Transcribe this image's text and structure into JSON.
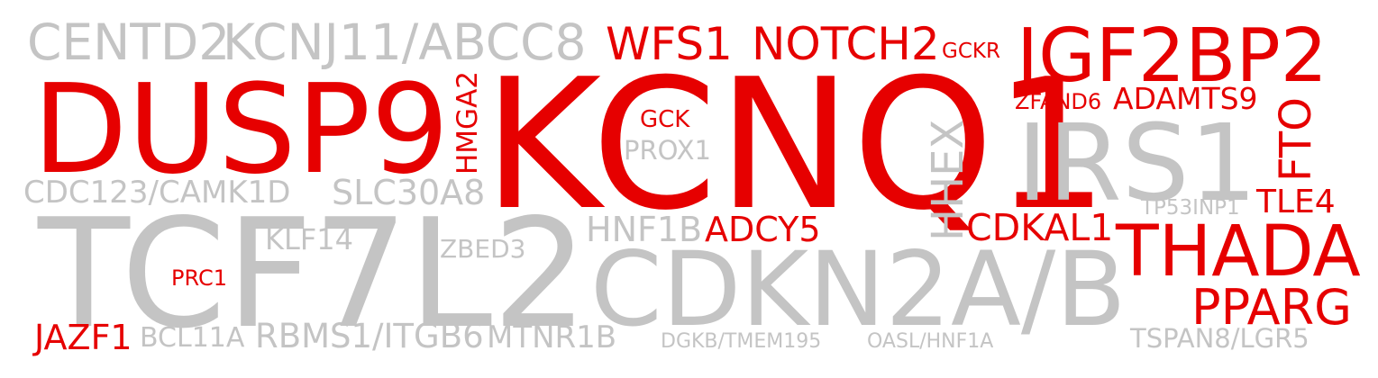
{
  "colors": {
    "highlight": "#e60000",
    "muted": "#c4c4c4",
    "background": "#ffffff"
  },
  "words": {
    "tcf7l2": "TCF7L2",
    "kcnq1": "KCNQ1",
    "cdkn2ab": "CDKN2A/B",
    "irs1": "IRS1",
    "dusp9": "DUSP9",
    "igf2bp2": "IGF2BP2",
    "centd2": "CENTD2",
    "kcnj11_abcc8": "KCNJ11/ABCC8",
    "wfs1": "WFS1",
    "notch2": "NOTCH2",
    "gckr": "GCKR",
    "hmga2": "HMGA2",
    "gck": "GCK",
    "prox1": "PROX1",
    "zfand6": "ZFAND6",
    "adamts9": "ADAMTS9",
    "fto": "FTO",
    "hhex": "HHEX",
    "cdc123_camk1d": "CDC123/CAMK1D",
    "slc30a8": "SLC30A8",
    "tp53inp1": "TP53INP1",
    "tle4": "TLE4",
    "hnf1b": "HNF1B",
    "adcy5": "ADCY5",
    "cdkal1": "CDKAL1",
    "klf14": "KLF14",
    "zbed3": "ZBED3",
    "thada": "THADA",
    "prc1": "PRC1",
    "pparg": "PPARG",
    "jazf1": "JAZF1",
    "bcl11a": "BCL11A",
    "rbms1_itgb6": "RBMS1/ITGB6",
    "mtnr1b": "MTNR1B",
    "dgkb_tmem195": "DGKB/TMEM195",
    "oasl_hnf1a": "OASL/HNF1A",
    "tspan8_lgr5": "TSPAN8/LGR5"
  }
}
